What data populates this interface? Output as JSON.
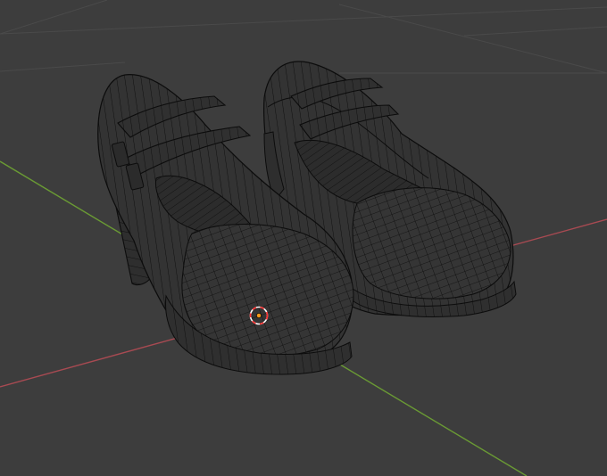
{
  "app": {
    "name": "3D viewport",
    "mode": "wireframe"
  },
  "viewport": {
    "background": "#3d3d3d",
    "grid_color": "#4a4a4a",
    "x_axis_color": "#a84a52",
    "y_axis_color": "#6a9a34",
    "mesh_fill": "#333333",
    "mesh_wire": "#0c0c0c",
    "cursor_ring_colors": [
      "#ff3030",
      "#ffffff"
    ],
    "origin_color": "#ff9a1a"
  },
  "scene": {
    "objects": [
      {
        "name": "shoe-left",
        "type": "mesh"
      },
      {
        "name": "shoe-right",
        "type": "mesh"
      }
    ],
    "cursor": {
      "name": "3d-cursor"
    },
    "origin": {
      "name": "object-origin"
    }
  }
}
